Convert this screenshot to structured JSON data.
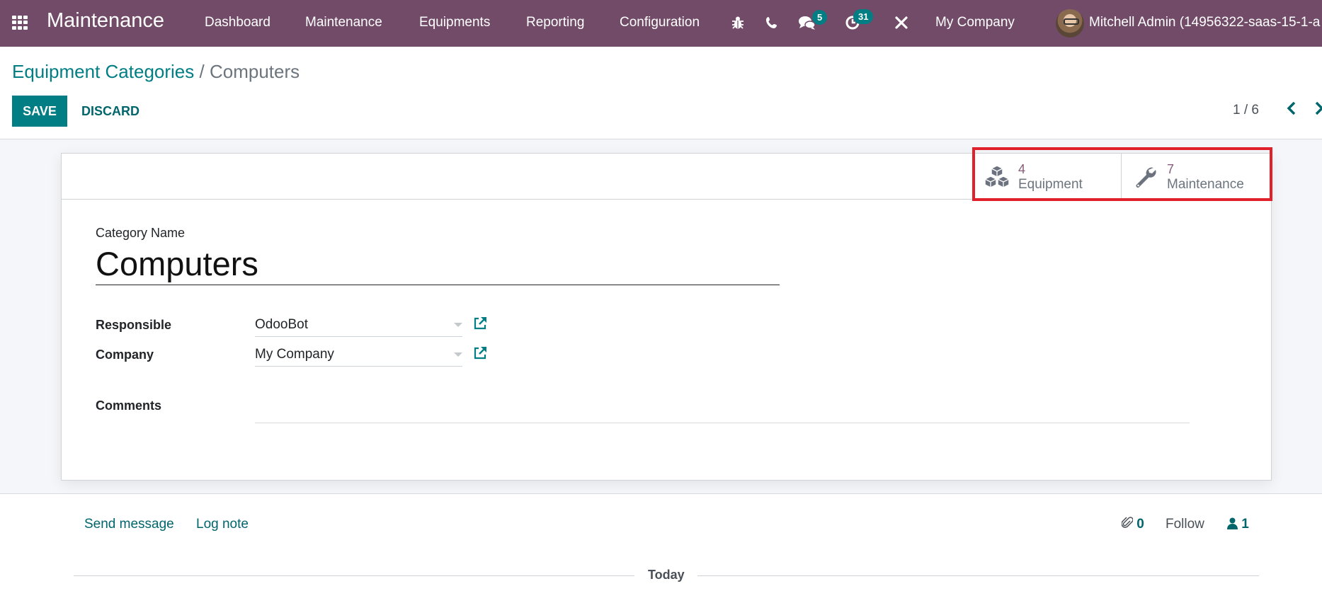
{
  "navbar": {
    "brand": "Maintenance",
    "menus": [
      "Dashboard",
      "Maintenance",
      "Equipments",
      "Reporting",
      "Configuration"
    ],
    "icons": {
      "apps": "apps-grid-icon",
      "debug": "bug-icon",
      "phone": "phone-icon",
      "messages": "chat-icon",
      "activities": "clock-icon",
      "tools": "tools-icon"
    },
    "messages_count": "5",
    "activities_count": "31",
    "company": "My Company",
    "user": "Mitchell Admin (14956322-saas-15-1-a"
  },
  "breadcrumb": {
    "parent": "Equipment Categories",
    "separator": "/",
    "current": "Computers"
  },
  "toolbar": {
    "save_label": "SAVE",
    "discard_label": "DISCARD"
  },
  "pager": {
    "value": "1 / 6",
    "prev_icon": "chevron-left-icon",
    "next_icon": "chevron-right-icon"
  },
  "stat_buttons": [
    {
      "value": "4",
      "label": "Equipment",
      "icon": "cubes-icon"
    },
    {
      "value": "7",
      "label": "Maintenance",
      "icon": "wrench-icon"
    }
  ],
  "form": {
    "category_name_label": "Category Name",
    "category_name_value": "Computers",
    "responsible_label": "Responsible",
    "responsible_value": "OdooBot",
    "company_label": "Company",
    "company_value": "My Company",
    "comments_label": "Comments",
    "comments_value": ""
  },
  "chatter": {
    "send_message": "Send message",
    "log_note": "Log note",
    "attachments_count": "0",
    "follow": "Follow",
    "followers_count": "1",
    "date_separator": "Today"
  },
  "colors": {
    "navbar": "#714B67",
    "primary": "#017e84",
    "stat_value": "#875A7B",
    "highlight": "#e0202a"
  }
}
